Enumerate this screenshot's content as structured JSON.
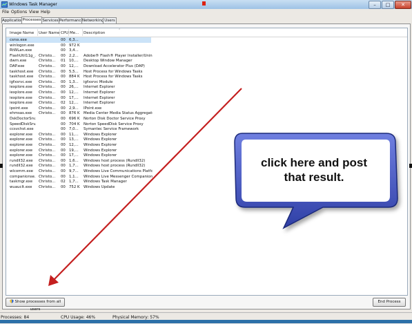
{
  "window": {
    "title": "Windows Task Manager",
    "min_glyph": "–",
    "max_glyph": "□",
    "close_glyph": "✕"
  },
  "menu": [
    "File",
    "Options",
    "View",
    "Help"
  ],
  "tabs": [
    {
      "label": "Applications",
      "active": false
    },
    {
      "label": "Processes",
      "active": true
    },
    {
      "label": "Services",
      "active": false
    },
    {
      "label": "Performance",
      "active": false
    },
    {
      "label": "Networking",
      "active": false
    },
    {
      "label": "Users",
      "active": false
    }
  ],
  "table": {
    "columns": [
      "Image Name",
      "User Name",
      "CPU",
      "Me...",
      "Description"
    ],
    "rows": [
      [
        "csrss.exe",
        "",
        "00",
        "6,3...",
        ""
      ],
      [
        "winlogon.exe",
        "",
        "00",
        "972 K",
        ""
      ],
      [
        "RtWLan.exe",
        "",
        "00",
        "3,4...",
        ""
      ],
      [
        "FlashUtil11g_...",
        "Christo...",
        "00",
        "2,2...",
        "Adobe® Flash® Player Installer/Unins..."
      ],
      [
        "dwm.exe",
        "Christo...",
        "01",
        "10,...",
        "Desktop Window Manager"
      ],
      [
        "DAP.exe",
        "Christo...",
        "00",
        "12,...",
        "Download Accelerator Plus (DAP)"
      ],
      [
        "taskhost.exe",
        "Christo...",
        "00",
        "5,5...",
        "Host Process for Windows Tasks"
      ],
      [
        "taskhost.exe",
        "Christo...",
        "00",
        "884 K",
        "Host Process for Windows Tasks"
      ],
      [
        "igfxsrvc.exe",
        "Christo...",
        "00",
        "1,3...",
        "igfxsrvc Module"
      ],
      [
        "iexplore.exe",
        "Christo...",
        "00",
        "26,...",
        "Internet Explorer"
      ],
      [
        "iexplore.exe",
        "Christo...",
        "00",
        "12,...",
        "Internet Explorer"
      ],
      [
        "iexplore.exe",
        "Christo...",
        "00",
        "17,...",
        "Internet Explorer"
      ],
      [
        "iexplore.exe",
        "Christo...",
        "02",
        "12,...",
        "Internet Explorer"
      ],
      [
        "ipoint.exe",
        "Christo...",
        "00",
        "2,9...",
        "IPoint.exe"
      ],
      [
        "ehmsas.exe",
        "Christo...",
        "00",
        "876 K",
        "Media Center Media Status Aggregato..."
      ],
      [
        "DskDoctorSrv...",
        "",
        "00",
        "696 K",
        "Norton Disk Doctor Service Proxy"
      ],
      [
        "SpeedDiskSrv...",
        "",
        "00",
        "704 K",
        "Norton SpeedDisk Service Proxy"
      ],
      [
        "ccsvchst.exe",
        "",
        "00",
        "7,0...",
        "Symantec Service Framework"
      ],
      [
        "explorer.exe",
        "Christo...",
        "00",
        "11,...",
        "Windows Explorer"
      ],
      [
        "explorer.exe",
        "Christo...",
        "00",
        "13,...",
        "Windows Explorer"
      ],
      [
        "explorer.exe",
        "Christo...",
        "00",
        "12,...",
        "Windows Explorer"
      ],
      [
        "explorer.exe",
        "Christo...",
        "00",
        "19,...",
        "Windows Explorer"
      ],
      [
        "explorer.exe",
        "Christo...",
        "00",
        "17,...",
        "Windows Explorer"
      ],
      [
        "rundll32.exe",
        "Christo...",
        "00",
        "1,6...",
        "Windows host process (Rundll32)"
      ],
      [
        "rundll32.exe",
        "Christo...",
        "00",
        "1,7...",
        "Windows host process (Rundll32)"
      ],
      [
        "wlcomm.exe",
        "Christo...",
        "00",
        "9,7...",
        "Windows Live Communications Platform"
      ],
      [
        "companionse...",
        "Christo...",
        "00",
        "1,1...",
        "Windows Live Messenger Companion U..."
      ],
      [
        "taskmgr.exe",
        "Christo...",
        "02",
        "1,7...",
        "Windows Task Manager"
      ],
      [
        "wuauclt.exe",
        "Christo...",
        "00",
        "752 K",
        "Windows Update"
      ]
    ]
  },
  "buttons": {
    "show_all": "Show processes from all users",
    "end_process": "End Process"
  },
  "status": {
    "processes": "Processes: 84",
    "cpu": "CPU Usage: 46%",
    "memory": "Physical Memory: 57%"
  },
  "callout": {
    "line1": "click here and post",
    "line2": "that result."
  },
  "colors": {
    "arrow": "#c41f1f",
    "callout_fill": "#4f5fc9",
    "title_bar": "#b7d1ec"
  }
}
